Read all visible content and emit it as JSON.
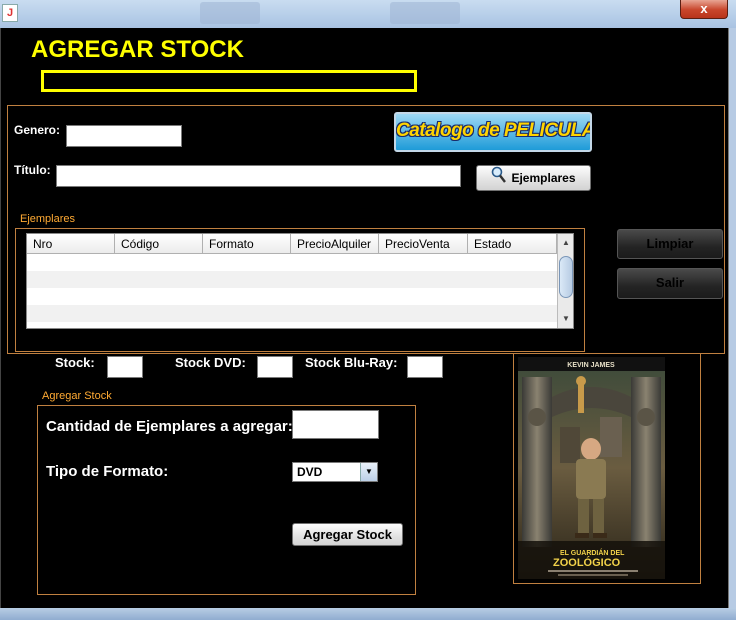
{
  "window": {
    "close_glyph": "x",
    "icon_glyph": "J"
  },
  "header": {
    "title": "AGREGAR STOCK"
  },
  "form": {
    "genero_label": "Genero:",
    "genero_value": "",
    "titulo_label": "Título:",
    "titulo_value": "",
    "catalog_button": "Catalogo de PELICULAS",
    "ejemplares_button": "Ejemplares"
  },
  "ejemplares": {
    "group_title": "Ejemplares",
    "columns": [
      "Nro",
      "Código",
      "Formato",
      "PrecioAlquiler",
      "PrecioVenta",
      "Estado"
    ],
    "rows": []
  },
  "side_buttons": {
    "limpiar": "Limpiar",
    "salir": "Salir"
  },
  "stock": {
    "stock_label": "Stock:",
    "stock_value": "",
    "dvd_label": "Stock DVD:",
    "dvd_value": "",
    "bluray_label": "Stock Blu-Ray:",
    "bluray_value": ""
  },
  "agregar": {
    "group_title": "Agregar Stock",
    "cantidad_label": "Cantidad de Ejemplares a agregar:",
    "cantidad_value": "",
    "formato_label": "Tipo de Formato:",
    "formato_selected": "DVD",
    "submit_button": "Agregar Stock"
  },
  "poster": {
    "actor": "KEVIN JAMES",
    "title_line1": "EL GUARDIÁN DEL",
    "title_line2": "ZOOLÓGICO"
  },
  "colors": {
    "accent": "#ffff00",
    "group_border": "#c08040",
    "background": "#000000"
  }
}
